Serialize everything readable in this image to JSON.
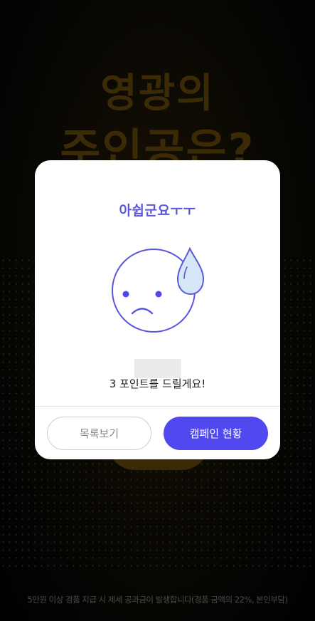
{
  "background": {
    "title_line1": "영광의",
    "title_line2": "주인공은?",
    "footer_notice": "5만원 이상 경품 지급 시 제세 공과금이 발생합니다(경품 금액의 22%, 본인부담)"
  },
  "dialog": {
    "title": "아쉽군요ㅜㅜ",
    "icon": "sad-face-with-sweat-drop-icon",
    "points_message": "3 포인트를 드릴게요!",
    "buttons": {
      "list_label": "목록보기",
      "campaign_label": "캠페인 현황"
    }
  },
  "colors": {
    "accent": "#5148f0",
    "title": "#5b57d9",
    "icon_stroke": "#5b57d9",
    "drop_fill": "#d6e7f7"
  }
}
